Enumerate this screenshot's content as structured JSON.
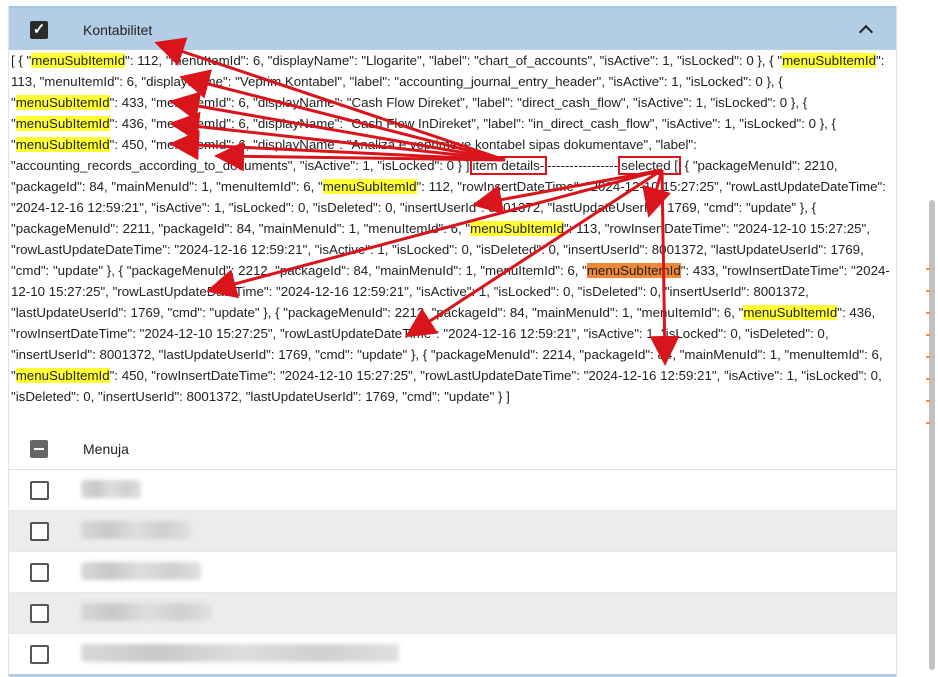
{
  "header": {
    "title": "Kontabilitet"
  },
  "log": {
    "segments": [
      {
        "t": "[ { \"",
        "c": ""
      },
      {
        "t": "menuSubItemId",
        "c": "hl-y"
      },
      {
        "t": "\": 112, \"menuItemId\": 6, \"displayName\": \"Llogarite\", \"label\": \"chart_of_accounts\", \"isActive\": 1, \"isLocked\": 0 }, { \"",
        "c": ""
      },
      {
        "t": "menuSubItemId",
        "c": "hl-y"
      },
      {
        "t": "\": 113, \"menuItemId\": 6, \"displayName\": \"Veprim Kontabel\", \"label\": \"accounting_journal_entry_header\", \"isActive\": 1, \"isLocked\": 0 }, { \"",
        "c": ""
      },
      {
        "t": "menuSubItemId",
        "c": "hl-y"
      },
      {
        "t": "\": 433, \"menuItemId\": 6, \"displayName\": \"Cash Flow Direket\", \"label\": \"direct_cash_flow\", \"isActive\": 1, \"isLocked\": 0 }, { \"",
        "c": ""
      },
      {
        "t": "menuSubItemId",
        "c": "hl-y"
      },
      {
        "t": "\": 436, \"menuItemId\": 6, \"displayName\": \"Cash Flow InDireket\", \"label\": \"in_direct_cash_flow\", \"isActive\": 1, \"isLocked\": 0 }, { \"",
        "c": ""
      },
      {
        "t": "menuSubItemId",
        "c": "hl-y"
      },
      {
        "t": "\": 450, \"menuItemId\": 6, \"displayName\": \"Analiza e veprimeve kontabel sipas dokumentave\", \"label\": \"accounting_records_according_to_documents\", \"isActive\": 1, \"isLocked\": 0 } ]",
        "c": ""
      },
      {
        "t": "item details-",
        "c": "boxed"
      },
      {
        "t": "----------------",
        "c": ""
      },
      {
        "t": "selected [",
        "c": "boxed"
      },
      {
        "t": " { \"packageMenuId\": 2210, \"packageId\": 84, \"mainMenuId\": 1, \"menuItemId\": 6, \"",
        "c": ""
      },
      {
        "t": "menuSubItemId",
        "c": "hl-y"
      },
      {
        "t": "\": 112, \"rowInsertDateTime\": \"2024-12-10 15:27:25\", \"rowLastUpdateDateTime\": \"2024-12-16 12:59:21\", \"isActive\": 1, \"isLocked\": 0, \"isDeleted\": 0, \"insertUserId\": 8001372, \"lastUpdateUserId\": 1769, \"cmd\": \"update\" }, { \"packageMenuId\": 2211, \"packageId\": 84, \"mainMenuId\": 1, \"menuItemId\": 6, \"",
        "c": ""
      },
      {
        "t": "menuSubItemId",
        "c": "hl-y"
      },
      {
        "t": "\": 113, \"rowInsertDateTime\": \"2024-12-10 15:27:25\", \"rowLastUpdateDateTime\": \"2024-12-16 12:59:21\", \"isActive\": 1, \"isLocked\": 0, \"isDeleted\": 0, \"insertUserId\": 8001372, \"lastUpdateUserId\": 1769, \"cmd\": \"update\" }, { \"packageMenuId\": 2212, \"packageId\": 84, \"mainMenuId\": 1, \"menuItemId\": 6, \"",
        "c": ""
      },
      {
        "t": "menuSubItemId",
        "c": "hl-o"
      },
      {
        "t": "\": 433, \"rowInsertDateTime\": \"2024-12-10 15:27:25\", \"rowLastUpdateDateTime\": \"2024-12-16 12:59:21\", \"isActive\": 1, \"isLocked\": 0, \"isDeleted\": 0, \"insertUserId\": 8001372, \"lastUpdateUserId\": 1769, \"cmd\": \"update\" }, { \"packageMenuId\": 2213, \"packageId\": 84, \"mainMenuId\": 1, \"menuItemId\": 6, \"",
        "c": ""
      },
      {
        "t": "menuSubItemId",
        "c": "hl-y"
      },
      {
        "t": "\": 436, \"rowInsertDateTime\": \"2024-12-10 15:27:25\", \"rowLastUpdateDateTime\": \"2024-12-16 12:59:21\", \"isActive\": 1, \"isLocked\": 0, \"isDeleted\": 0, \"insertUserId\": 8001372, \"lastUpdateUserId\": 1769, \"cmd\": \"update\" }, { \"packageMenuId\": 2214, \"packageId\": 84, \"mainMenuId\": 1, \"menuItemId\": 6, \"",
        "c": ""
      },
      {
        "t": "menuSubItemId",
        "c": "hl-y"
      },
      {
        "t": "\": 450, \"rowInsertDateTime\": \"2024-12-10 15:27:25\", \"rowLastUpdateDateTime\": \"2024-12-16 12:59:21\", \"isActive\": 1, \"isLocked\": 0, \"isDeleted\": 0, \"insertUserId\": 8001372, \"lastUpdateUserId\": 1769, \"cmd\": \"update\" } ]",
        "c": ""
      }
    ]
  },
  "table": {
    "header_label": "Menuja",
    "rows": [
      {
        "label": "",
        "redacted": true
      },
      {
        "label": "",
        "redacted": true
      },
      {
        "label": "",
        "redacted": true
      },
      {
        "label": "",
        "redacted": true
      },
      {
        "label": "",
        "redacted": true
      }
    ]
  },
  "colors": {
    "header_bg": "#b3cde6",
    "highlight": "#ffff33",
    "highlight_alt": "#f0883a",
    "annotation": "#d9141a"
  }
}
